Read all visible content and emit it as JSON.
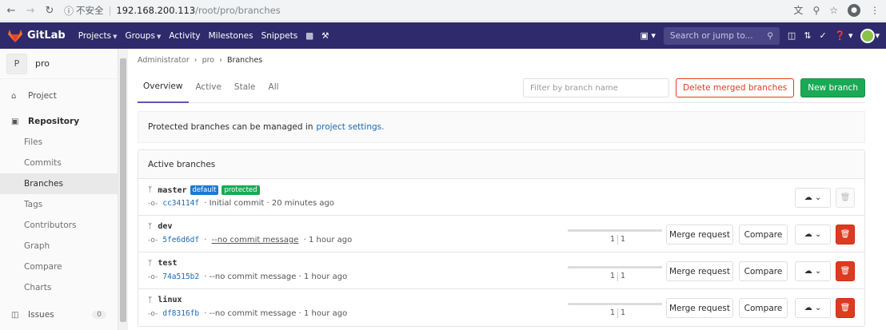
{
  "browser": {
    "security_label": "不安全",
    "url_host": "192.168.200.113",
    "url_path": "/root/pro/branches"
  },
  "header": {
    "logo_text": "GitLab",
    "nav": [
      "Projects",
      "Groups",
      "Activity",
      "Milestones",
      "Snippets"
    ],
    "search_placeholder": "Search or jump to..."
  },
  "sidebar": {
    "avatar_letter": "P",
    "project_name": "pro",
    "project_item": "Project",
    "repository_item": "Repository",
    "sub_items": [
      "Files",
      "Commits",
      "Branches",
      "Tags",
      "Contributors",
      "Graph",
      "Compare",
      "Charts"
    ],
    "issues_label": "Issues",
    "issues_count": "0"
  },
  "breadcrumb": {
    "items": [
      "Administrator",
      "pro",
      "Branches"
    ]
  },
  "tabs": [
    "Overview",
    "Active",
    "Stale",
    "All"
  ],
  "toolbar": {
    "filter_placeholder": "Filter by branch name",
    "delete_merged_label": "Delete merged branches",
    "new_branch_label": "New branch"
  },
  "notice": {
    "text": "Protected branches can be managed in",
    "link": "project settings."
  },
  "panel": {
    "title": "Active branches"
  },
  "branches": [
    {
      "name": "master",
      "default_tag": "default",
      "protected_tag": "protected",
      "sha": "cc34114f",
      "message": "Initial commit",
      "time": "20 minutes ago"
    },
    {
      "name": "dev",
      "sha": "5fe6d6df",
      "message": "--no commit message",
      "time": "1 hour ago",
      "behind": "1",
      "ahead": "1"
    },
    {
      "name": "test",
      "sha": "74a515b2",
      "message": "--no commit message",
      "time": "1 hour ago",
      "behind": "1",
      "ahead": "1"
    },
    {
      "name": "linux",
      "sha": "df8316fb",
      "message": "--no commit message",
      "time": "1 hour ago",
      "behind": "1",
      "ahead": "1"
    }
  ],
  "row_actions": {
    "merge_request": "Merge request",
    "compare": "Compare"
  },
  "colors": {
    "header_bg": "#2f2a6b",
    "link": "#1b69b6",
    "success": "#1aaa55",
    "danger": "#db3b21",
    "default_tag": "#1f78d1"
  }
}
